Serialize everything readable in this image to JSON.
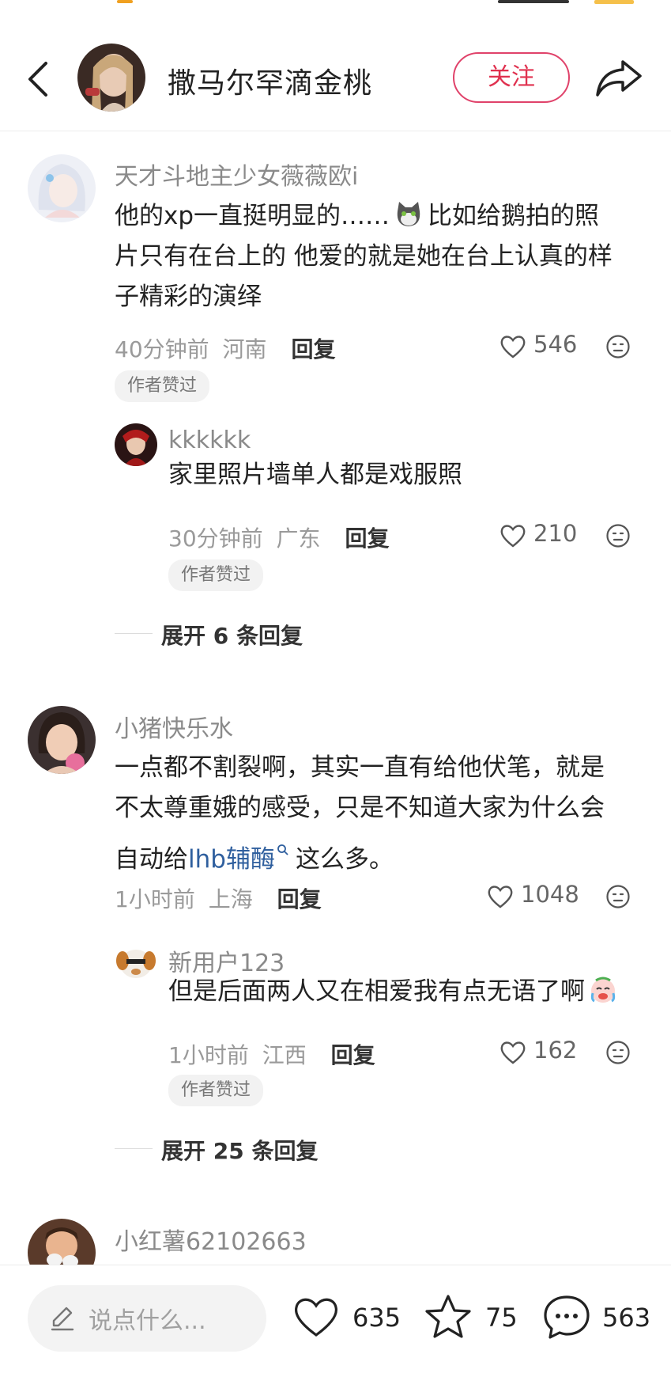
{
  "header": {
    "author_name": "撒马尔罕滴金桃",
    "follow_label": "关注"
  },
  "comments": [
    {
      "username": "天才斗地主少女薇薇欧i",
      "text_1": "他的xp一直挺明显的……",
      "text_1b": "比如给鹅拍的照",
      "text_2": "片只有在台上的 他爱的就是她在台上认真的样",
      "text_3": "子精彩的演绎",
      "time": "40分钟前",
      "location": "河南",
      "reply_label": "回复",
      "likes": "546",
      "badge": "作者赞过",
      "replies": [
        {
          "username": "kkkkkk",
          "text": "家里照片墙单人都是戏服照",
          "time": "30分钟前",
          "location": "广东",
          "reply_label": "回复",
          "likes": "210",
          "badge": "作者赞过"
        }
      ],
      "expand_label": "展开 6 条回复"
    },
    {
      "username": "小猪快乐水",
      "text_1": "一点都不割裂啊，其实一直有给他伏笔，就是",
      "text_2": "不太尊重娥的感受，只是不知道大家为什么会",
      "text_3a": "自动给",
      "text_3_link": "lhb辅酶",
      "text_3b": "这么多。",
      "time": "1小时前",
      "location": "上海",
      "reply_label": "回复",
      "likes": "1048",
      "replies": [
        {
          "username": "新用户123",
          "text": "但是后面两人又在相爱我有点无语了啊",
          "time": "1小时前",
          "location": "江西",
          "reply_label": "回复",
          "likes": "162",
          "badge": "作者赞过"
        }
      ],
      "expand_label": "展开 25 条回复"
    },
    {
      "username": "小红薯62102663"
    }
  ],
  "bottom": {
    "input_placeholder": "说点什么...",
    "likes": "635",
    "stars": "75",
    "comments": "563"
  },
  "colors": {
    "accent": "#e0314f",
    "link": "#2f5f9e"
  }
}
